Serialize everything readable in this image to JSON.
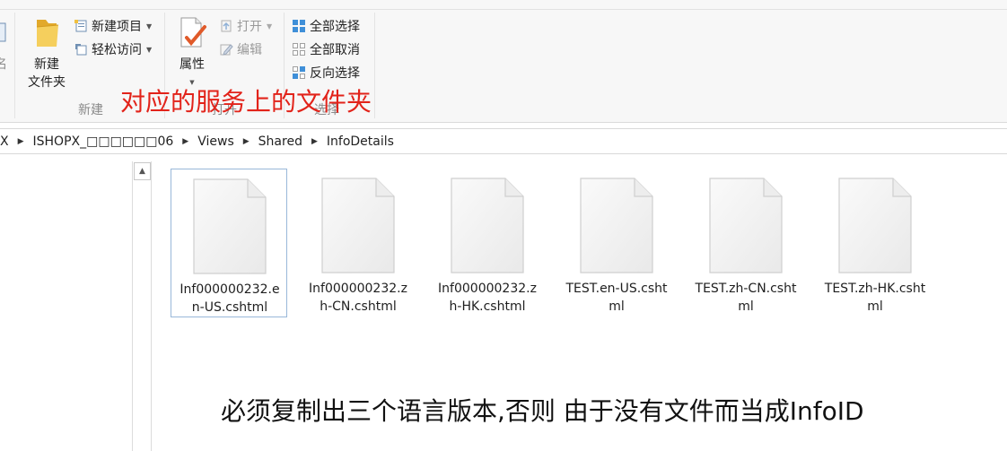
{
  "ribbon": {
    "partial_left_label": "名",
    "new_group": {
      "new_folder_label_line1": "新建",
      "new_folder_label_line2": "文件夹",
      "new_item_label": "新建项目",
      "easy_access_label": "轻松访问",
      "group_label": "新建"
    },
    "open_group": {
      "properties_label": "属性",
      "open_label": "打开",
      "edit_label": "编辑",
      "group_label": "打开"
    },
    "select_group": {
      "select_all_label": "全部选择",
      "select_none_label": "全部取消",
      "invert_selection_label": "反向选择",
      "group_label": "选择"
    }
  },
  "annotation_top": "对应的服务上的文件夹",
  "breadcrumb": {
    "items": [
      "X",
      "ISHOPX_□□□□□□06",
      "Views",
      "Shared",
      "InfoDetails"
    ]
  },
  "files": [
    {
      "name": "Inf000000232.en-US.cshtml",
      "selected": true
    },
    {
      "name": "Inf000000232.zh-CN.cshtml",
      "selected": false
    },
    {
      "name": "Inf000000232.zh-HK.cshtml",
      "selected": false
    },
    {
      "name": "TEST.en-US.cshtml",
      "selected": false
    },
    {
      "name": "TEST.zh-CN.cshtml",
      "selected": false
    },
    {
      "name": "TEST.zh-HK.cshtml",
      "selected": false
    }
  ],
  "annotation_bottom": "必须复制出三个语言版本,否则 由于没有文件而当成InfoID",
  "colors": {
    "annotation_red": "#e2231a",
    "selection_border": "#99b8d9",
    "ribbon_bg": "#f7f7f7"
  }
}
